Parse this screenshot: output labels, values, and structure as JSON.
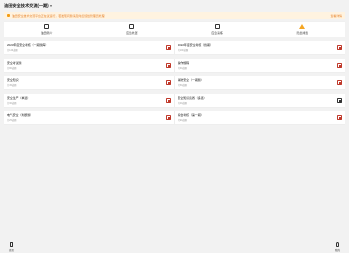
{
  "header": {
    "title": "油田安全技术交流(一期)",
    "caret": "▾"
  },
  "notice": {
    "text": "油田安全技术交流平台正在试运行，若发现问题请及时反馈给管理员处理",
    "link": "查看详情"
  },
  "tabs": [
    {
      "label": "油田简介",
      "icon": "book-icon"
    },
    {
      "label": "应急处置",
      "icon": "inbox-icon"
    },
    {
      "label": "应急演练",
      "icon": "checklist-icon"
    },
    {
      "label": "隐患排查",
      "icon": "warning-icon"
    }
  ],
  "rows": [
    {
      "left": {
        "name": "2023年度安全考核（一期题库）",
        "sub": "共120道题"
      },
      "right": {
        "name": "2022年度安全考核（终期）",
        "sub": "共100道题"
      }
    },
    {
      "left": {
        "name": "安全考试题",
        "sub": "共80道题"
      },
      "right": {
        "name": "操作规程",
        "sub": "共60道题"
      }
    },
    {
      "left": {
        "name": "安全知识",
        "sub": "共45道题"
      },
      "right": {
        "name": "消防安全（一期题）",
        "sub": "共50道题"
      }
    },
    {
      "left": {
        "name": "安全生产（单选）",
        "sub": "共30道题"
      },
      "right": {
        "name": "安全知识竞赛（多选）",
        "sub": "共40道题"
      }
    },
    {
      "left": {
        "name": "电气安全（判断题）",
        "sub": "共25道题"
      },
      "right": {
        "name": "综合考核（第一期）",
        "sub": "共90道题"
      }
    }
  ],
  "right_button_styles": [
    "red",
    "red",
    "red",
    "dark",
    "red"
  ],
  "bottom_nav": {
    "left": "首页",
    "right": "我的"
  },
  "colors": {
    "accent": "#f39c12",
    "danger": "#c0392b",
    "notice_bg": "#fff3e0"
  }
}
